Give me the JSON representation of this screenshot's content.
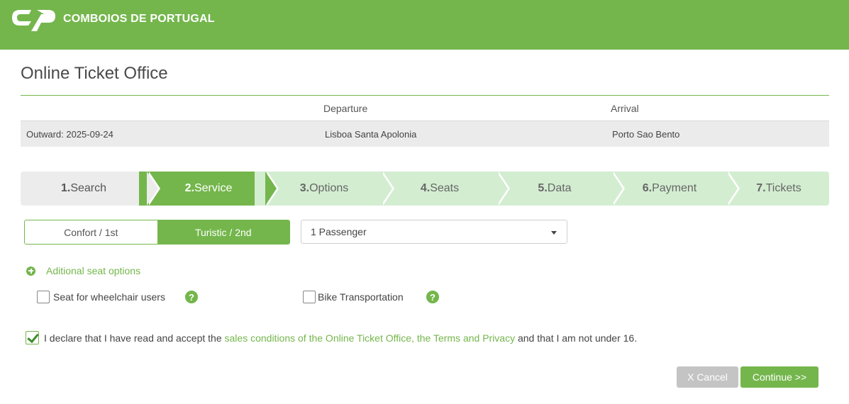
{
  "header": {
    "brand": "COMBOIOS DE PORTUGAL",
    "logo_icon": "cp-logo-icon",
    "bg_color": "#74b64c"
  },
  "page": {
    "title": "Online Ticket Office"
  },
  "trip": {
    "headers": {
      "departure": "Departure",
      "arrival": "Arrival"
    },
    "outward_label": "Outward: 2025-09-24",
    "departure": "Lisboa Santa Apolonia",
    "arrival": "Porto Sao Bento"
  },
  "steps": [
    {
      "num": "1.",
      "label": "Search",
      "state": "done"
    },
    {
      "num": "2.",
      "label": "Service",
      "state": "active"
    },
    {
      "num": "3.",
      "label": "Options",
      "state": "pending"
    },
    {
      "num": "4.",
      "label": "Seats",
      "state": "pending"
    },
    {
      "num": "5.",
      "label": "Data",
      "state": "pending"
    },
    {
      "num": "6.",
      "label": "Payment",
      "state": "pending"
    },
    {
      "num": "7.",
      "label": "Tickets",
      "state": "pending"
    }
  ],
  "service": {
    "class_options": [
      "Confort / 1st",
      "Turistic / 2nd"
    ],
    "selected_class": "Turistic / 2nd",
    "passengers": "1 Passenger"
  },
  "seat_options": {
    "toggle_label": "Aditional seat options",
    "wheelchair": "Seat for wheelchair users",
    "bike": "Bike Transportation",
    "help_glyph": "?"
  },
  "declaration": {
    "prefix": "I declare that I have read and accept the ",
    "link": "sales conditions of the Online Ticket Office, the Terms and Privacy",
    "suffix": " and that I am not under 16.",
    "checked": true
  },
  "buttons": {
    "cancel": "X Cancel",
    "continue": "Continue >>"
  },
  "colors": {
    "accent": "#74b64c",
    "step_pending": "#d3edd1",
    "step_done": "#ececec",
    "cancel_bg": "#c4c4c4"
  }
}
